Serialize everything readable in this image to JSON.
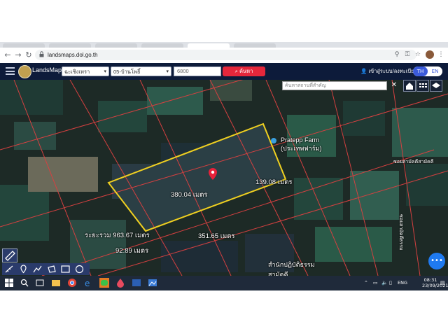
{
  "browser": {
    "url": "landsmaps.dol.go.th"
  },
  "app": {
    "name": "LandsMaps",
    "province_value": "ฉะเชิงเทรา",
    "district_value": "05-บ้านโพธิ์",
    "parcel_input_value": "6800",
    "search_button": "ค้นหา",
    "login_link": "เข้าสู่ระบบ/ลงทะเบียน",
    "lang_th": "TH",
    "lang_en": "EN"
  },
  "map": {
    "place_search_placeholder": "ค้นหาสถานที่สำคัญ",
    "poi_farm_line1": "Pratepp Farm",
    "poi_farm_line2": "(ประเทพฟาร์ม)",
    "poi_monastery_line1": "สำนักปฏิบัติธรรม",
    "poi_monastery_line2": "สามัคคี",
    "road_label_top": "ซอยสามัคคีสามัคคี",
    "road_label_right": "ซอยสามัคคีธรรม",
    "measurements": {
      "top_edge": "380.04 เมตร",
      "right_edge": "139.08 เมตร",
      "bottom_edge": "351.65 เมตร",
      "left_edge": "92.89 เมตร",
      "perimeter": "ระยะรวม 963.67 เมตร"
    },
    "colors": {
      "parcel_outline": "#f0d020",
      "boundary_lines": "#d64040",
      "marker": "#e8213a"
    }
  },
  "taskbar": {
    "language": "ENG",
    "time": "08:31",
    "date": "23/09/2021"
  }
}
